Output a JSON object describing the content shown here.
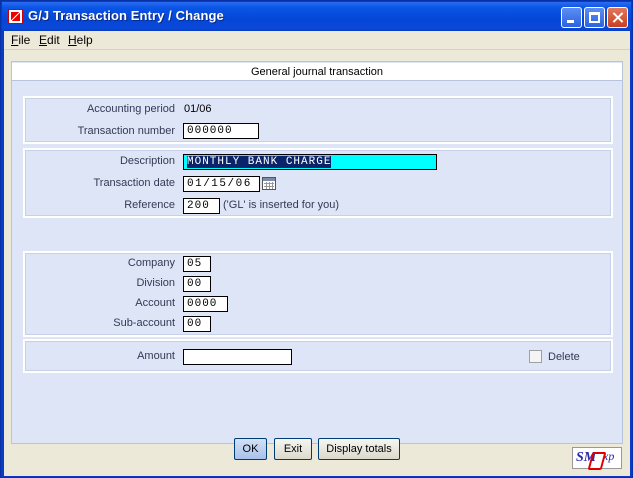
{
  "window": {
    "title": "G/J Transaction Entry / Change"
  },
  "menu": {
    "file": {
      "first": "F",
      "rest": "ile"
    },
    "edit": {
      "first": "E",
      "rest": "dit"
    },
    "help": {
      "first": "H",
      "rest": "elp"
    }
  },
  "panel": {
    "header": "General journal transaction"
  },
  "period_group": {
    "accounting_period_label": "Accounting period",
    "accounting_period_value": "01/06",
    "transaction_number_label": "Transaction number",
    "transaction_number_value": "000000"
  },
  "detail_group": {
    "description_label": "Description",
    "description_value": "MONTHLY BANK CHARGE",
    "transaction_date_label": "Transaction date",
    "transaction_date_value": "01/15/06",
    "reference_label": "Reference",
    "reference_value": "200",
    "reference_hint": "('GL' is inserted for you)"
  },
  "account_group": {
    "company_label": "Company",
    "company_value": "05",
    "division_label": "Division",
    "division_value": "00",
    "account_label": "Account",
    "account_value": "0000",
    "subaccount_label": "Sub-account",
    "subaccount_value": "00"
  },
  "amount_group": {
    "amount_label": "Amount",
    "amount_value": "",
    "delete_label": "Delete",
    "delete_checked": false
  },
  "buttons": {
    "ok": "OK",
    "exit": "Exit",
    "display_totals": "Display totals"
  },
  "logo": {
    "text": "SM",
    "sup": "xp"
  },
  "colors": {
    "titlebar": "#0546d6",
    "panel_bg": "#dde5f7",
    "field_highlight": "#00ffff",
    "selection": "#0a246a"
  }
}
